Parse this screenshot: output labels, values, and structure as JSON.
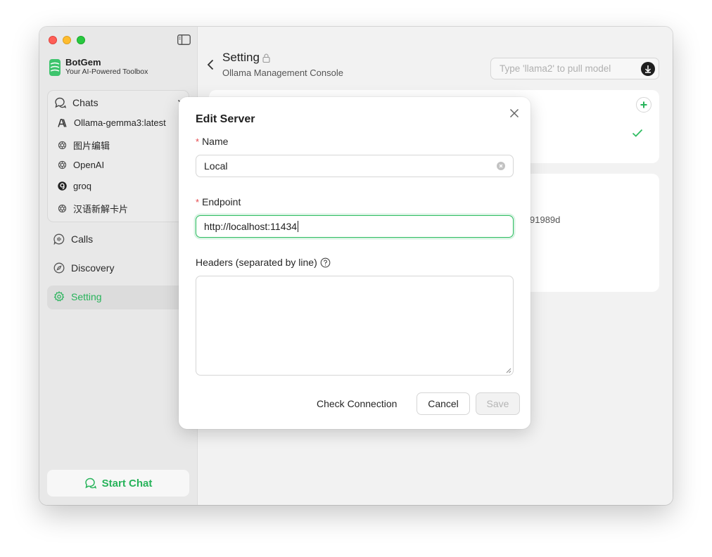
{
  "sidebar": {
    "brand": {
      "name": "BotGem",
      "tagline": "Your AI-Powered Toolbox"
    },
    "chats_label": "Chats",
    "chats": [
      {
        "label": "Ollama-gemma3:latest",
        "icon": "anthropic-icon"
      },
      {
        "label": "图片编辑",
        "icon": "openai-icon"
      },
      {
        "label": "OpenAI",
        "icon": "openai-icon"
      },
      {
        "label": "groq",
        "icon": "groq-icon"
      },
      {
        "label": "汉语新解卡片",
        "icon": "openai-icon"
      }
    ],
    "nav": [
      {
        "label": "Calls",
        "icon": "calls-icon"
      },
      {
        "label": "Discovery",
        "icon": "compass-icon"
      },
      {
        "label": "Setting",
        "icon": "gear-icon",
        "active": true
      }
    ],
    "start_chat_label": "Start Chat"
  },
  "header": {
    "title": "Setting",
    "subtitle": "Ollama Management Console",
    "pull_placeholder": "Type 'llama2' to pull model"
  },
  "background": {
    "partial_text": "91989d"
  },
  "modal": {
    "title": "Edit Server",
    "name_label": "Name",
    "name_value": "Local",
    "endpoint_label": "Endpoint",
    "endpoint_value": "http://localhost:11434",
    "headers_label": "Headers (separated by line)",
    "check_label": "Check Connection",
    "cancel_label": "Cancel",
    "save_label": "Save"
  },
  "colors": {
    "accent": "#27b35a",
    "required": "#e5484d"
  }
}
